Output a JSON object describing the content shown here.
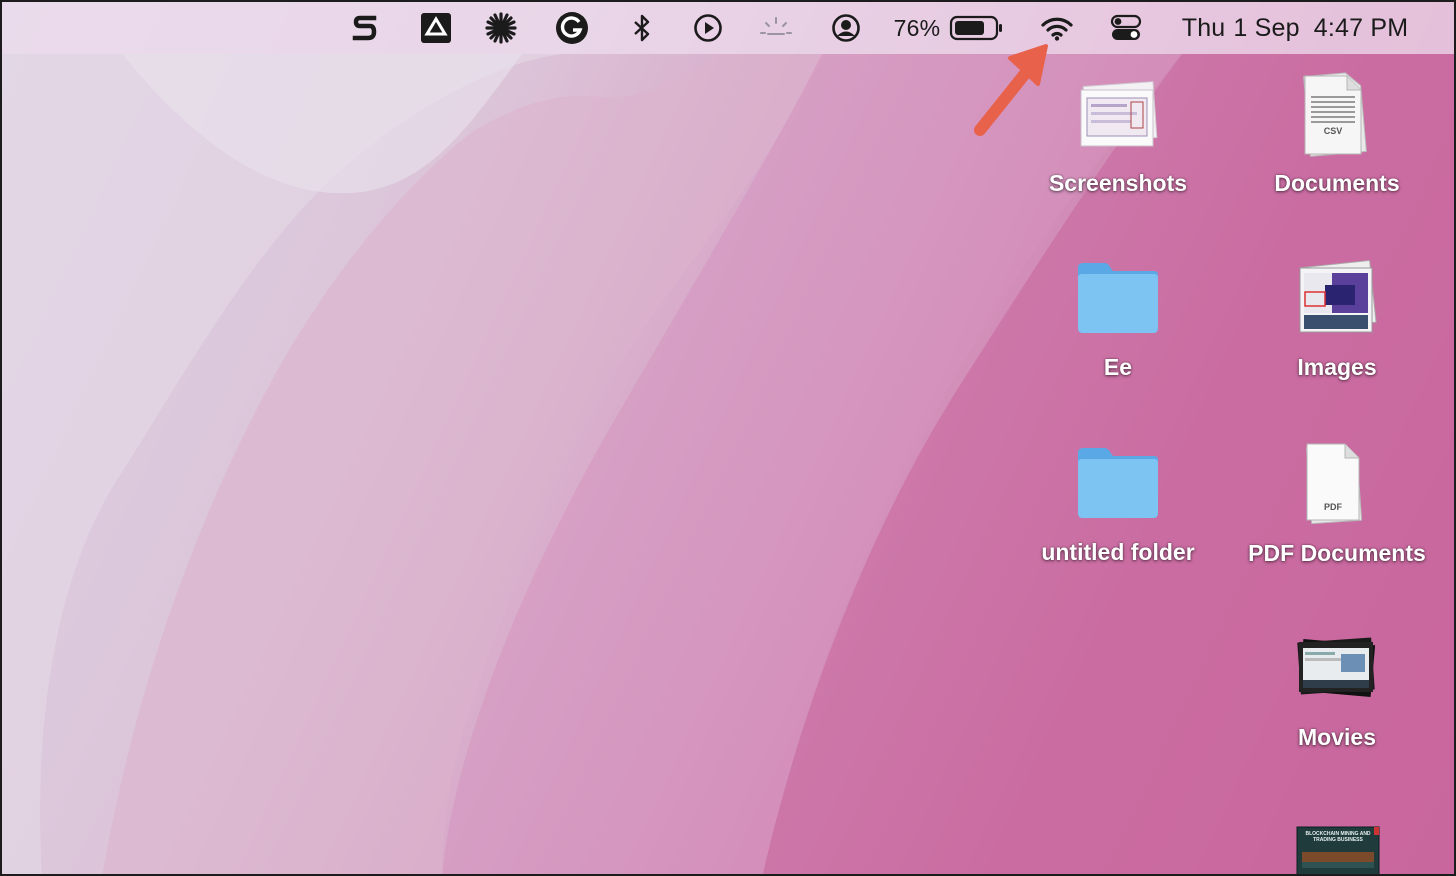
{
  "menubar": {
    "battery_percent": "76%",
    "day": "Thu",
    "date": "1 Sep",
    "time": "4:47 PM",
    "icons": [
      "setapp-icon",
      "drive-icon",
      "perplexity-icon",
      "grammarly-icon",
      "bluetooth-icon",
      "play-icon",
      "brightness-icon",
      "user-icon",
      "battery-icon",
      "wifi-icon",
      "control-center-icon"
    ]
  },
  "desktop": {
    "items": [
      {
        "label": "Screenshots",
        "kind": "stack-screenshots"
      },
      {
        "label": "Documents",
        "kind": "stack-csv"
      },
      {
        "label": "Ee",
        "kind": "folder"
      },
      {
        "label": "Images",
        "kind": "stack-images"
      },
      {
        "label": "untitled folder",
        "kind": "folder"
      },
      {
        "label": "PDF Documents",
        "kind": "stack-pdf"
      },
      {
        "label": "Movies",
        "kind": "stack-movies"
      }
    ],
    "partial_item_caption": "BLOCKCHAIN MINING AND TRADING BUSINESS"
  },
  "colors": {
    "annotation_arrow": "#e8624b",
    "folder_blue": "#7ec4f3"
  }
}
